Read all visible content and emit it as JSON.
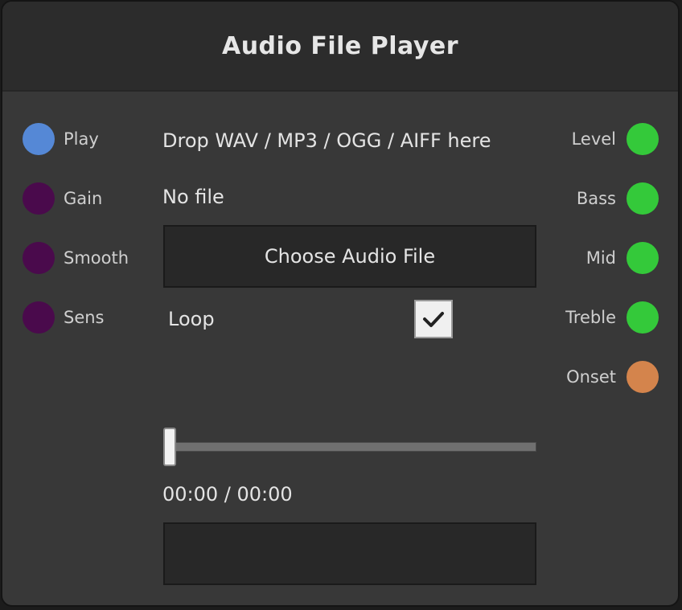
{
  "node": {
    "title": "Audio File Player"
  },
  "inputs": [
    {
      "label": "Play",
      "color": "#5588d6"
    },
    {
      "label": "Gain",
      "color": "#4a0a4c"
    },
    {
      "label": "Smooth",
      "color": "#4a0a4c"
    },
    {
      "label": "Sens",
      "color": "#4a0a4c"
    }
  ],
  "outputs": [
    {
      "label": "Level",
      "color": "#34c93a"
    },
    {
      "label": "Bass",
      "color": "#34c93a"
    },
    {
      "label": "Mid",
      "color": "#34c93a"
    },
    {
      "label": "Treble",
      "color": "#34c93a"
    },
    {
      "label": "Onset",
      "color": "#d4844c"
    }
  ],
  "drop_hint": "Drop WAV / MP3 / OGG / AIFF here",
  "file_status": "No file",
  "choose_button": "Choose Audio File",
  "loop": {
    "label": "Loop",
    "checked": true
  },
  "position": {
    "progress": 0,
    "time": "00:00 / 00:00"
  },
  "icons": {
    "checkbox": "checkmark-icon"
  }
}
